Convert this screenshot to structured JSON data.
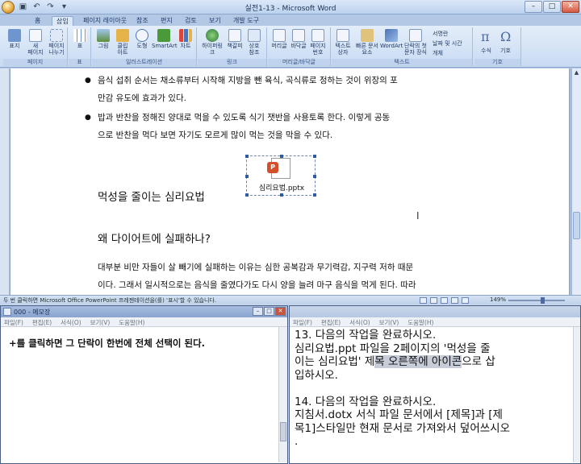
{
  "word": {
    "title": "실전1-13 - Microsoft Word",
    "tabs": [
      "홈",
      "삽입",
      "페이지 레이아웃",
      "참조",
      "편지",
      "검토",
      "보기",
      "개발 도구"
    ],
    "active_tab": "삽입",
    "ribbon": {
      "groups": [
        {
          "label": "페이지",
          "buttons": [
            "표지",
            "새\n페이지",
            "페이지\n나누기"
          ]
        },
        {
          "label": "표",
          "buttons": [
            "표"
          ]
        },
        {
          "label": "일러스트레이션",
          "buttons": [
            "그림",
            "클립\n아트",
            "도형",
            "SmartArt",
            "차트"
          ]
        },
        {
          "label": "링크",
          "buttons": [
            "하이퍼링크",
            "책갈피",
            "상호\n참조"
          ]
        },
        {
          "label": "머리글/바닥글",
          "buttons": [
            "머리글",
            "바닥글",
            "페이지\n번호"
          ]
        },
        {
          "label": "텍스트",
          "buttons": [
            "텍스트\n상자",
            "빠른 문서\n요소",
            "WordArt",
            "단락의 첫\n문자 장식"
          ]
        },
        {
          "label": "기호",
          "buttons": [
            "수식",
            "기호"
          ]
        }
      ],
      "small": [
        "서명란",
        "날짜 및 시간",
        "개체"
      ]
    },
    "document": {
      "bullets": [
        [
          "음식 섭취 순서는 채소류부터 시작해 지방을 뺀 육식, 곡식류로 정하는 것이 위장의 포",
          "만감 유도에 효과가 있다."
        ],
        [
          "밥과 반찬을 정해진 양대로 먹을 수 있도록 식기 잿반을 사용토록 한다. 이렇게 공동",
          "으로 반찬을 먹다 보면 자기도 모르게 많이 먹는 것을 막을 수 있다."
        ]
      ],
      "embedded_object": "심리요법.pptx",
      "heading1": "먹성을 줄이는 심리요법",
      "heading2": "왜 다이어트에 실패하나?",
      "para": [
        "대부분 비만 자들이 살 빼기에 실패하는 이유는 심한 공복감과 무기력감, 지구력 저하 때문",
        "이다. 그래서 일시적으로는 음식을 줄였다가도 다시 양을 늘려 마구 음식을 먹게 된다. 따라"
      ]
    },
    "status": "두 번 클릭하면 Microsoft Office PowerPoint 프레젠테이션을(를) '표시'할 수 있습니다.",
    "zoom": "149%"
  },
  "notepad1": {
    "title": "000 - 메모장",
    "menu": [
      "파일(F)",
      "편집(E)",
      "서식(O)",
      "보기(V)",
      "도움말(H)"
    ],
    "text": "+를 클릭하면 그 단락이 한번에 전체 선택이 된다."
  },
  "notepad2": {
    "menu": [
      "파일(F)",
      "편집(E)",
      "서식(O)",
      "보기(V)",
      "도움말(H)"
    ],
    "lines": [
      "13. 다음의 작업을 완료하시오.",
      "   심리요법.ppt 파일을 2페이지의  '먹성을 줄",
      "이는 심리요법'  제",
      "목 오른쪽에 아이콘",
      "으로 삽",
      "입하시오.",
      "",
      "14. 다음의 작업을 완료하시오.",
      "   지침서.dotx 서식 파일 문서에서 [제목]과 [제",
      "목1]스타일만 현재 문서로 가져와서 덮어쓰시오",
      "."
    ]
  }
}
